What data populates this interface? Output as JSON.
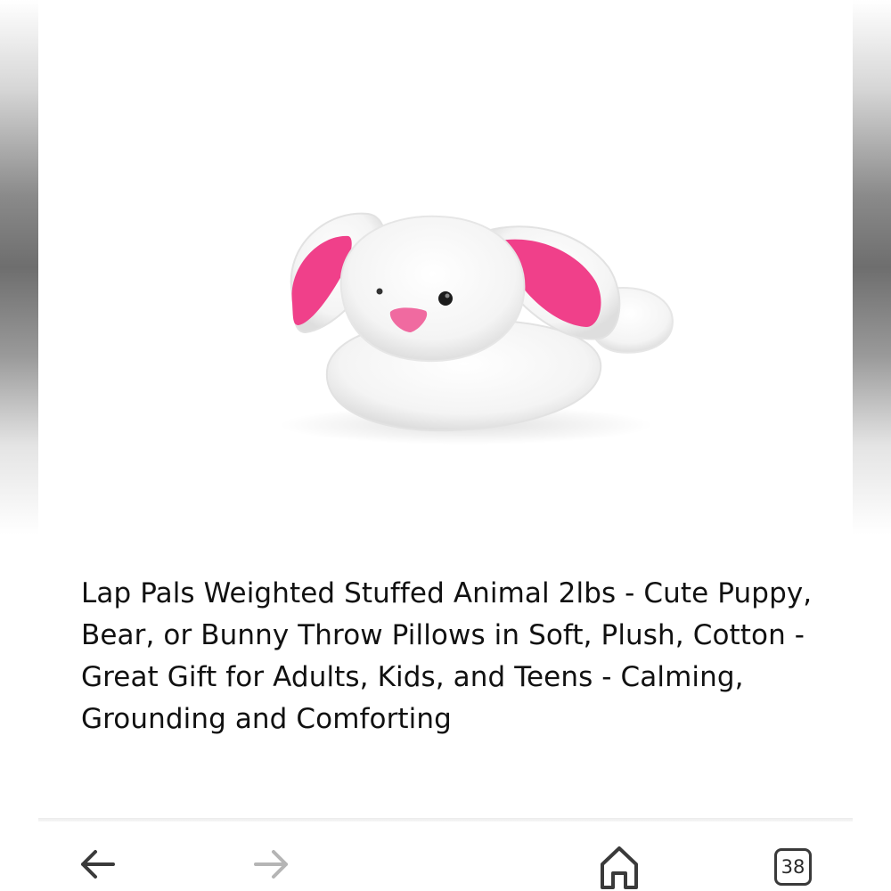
{
  "product": {
    "image_alt": "white plush bunny with pink ears",
    "title": "Lap Pals Weighted Stuffed Animal 2lbs - Cute Puppy, Bear, or Bunny Throw Pillows in Soft, Plush, Cotton - Great Gift for Adults, Kids, and Teens - Calming, Grounding and Comforting"
  },
  "toolbar": {
    "back_icon": "arrow-left-icon",
    "forward_icon": "arrow-right-icon",
    "home_icon": "home-icon",
    "tab_count": "38"
  },
  "colors": {
    "ear_pink": "#f0408a",
    "text": "#111111"
  }
}
